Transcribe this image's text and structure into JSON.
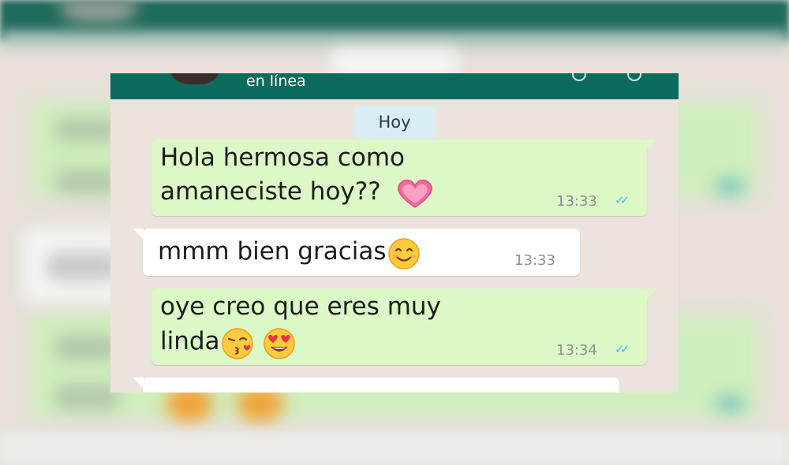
{
  "chat": {
    "status": "en línea",
    "date_chip": "Hoy",
    "messages": [
      {
        "direction": "outgoing",
        "line1": "Hola hermosa como",
        "line2": "amaneciste hoy??",
        "emoji": "pink-heart",
        "time": "13:33",
        "read_receipt": "double-check-blue"
      },
      {
        "direction": "incoming",
        "line1": "mmm bien gracias",
        "emoji": "smiling-face",
        "time": "13:33"
      },
      {
        "direction": "outgoing",
        "line1": "oye creo que eres muy",
        "line2": "linda",
        "emoji": "kissing-face, heart-eyes-face",
        "time": "13:34",
        "read_receipt": "double-check-blue"
      }
    ]
  },
  "colors": {
    "header": "#0b6b5c",
    "outgoing_bubble": "#dcf8c6",
    "incoming_bubble": "#ffffff",
    "date_chip": "#d9edf6",
    "read_ticks": "#4fb6ec",
    "background": "#ebe4dc"
  }
}
